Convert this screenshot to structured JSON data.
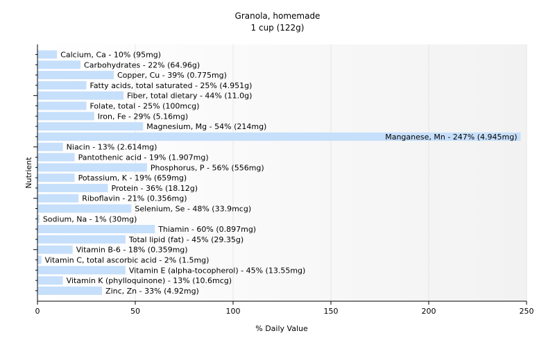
{
  "chart_data": {
    "type": "bar",
    "orientation": "horizontal",
    "title": "Granola, homemade",
    "subtitle": "1 cup (122g)",
    "xlabel": "% Daily Value",
    "ylabel": "Nutrient",
    "xlim": [
      0,
      250
    ],
    "xticks": [
      0,
      50,
      100,
      150,
      200,
      250
    ],
    "grid": true,
    "legend": "none",
    "categories": [
      "Calcium, Ca - 10% (95mg)",
      "Carbohydrates - 22% (64.96g)",
      "Copper, Cu - 39% (0.775mg)",
      "Fatty acids, total saturated - 25% (4.951g)",
      "Fiber, total dietary - 44% (11.0g)",
      "Folate, total - 25% (100mcg)",
      "Iron, Fe - 29% (5.16mg)",
      "Magnesium, Mg - 54% (214mg)",
      "Manganese, Mn - 247% (4.945mg)",
      "Niacin - 13% (2.614mg)",
      "Pantothenic acid - 19% (1.907mg)",
      "Phosphorus, P - 56% (556mg)",
      "Potassium, K - 19% (659mg)",
      "Protein - 36% (18.12g)",
      "Riboflavin - 21% (0.356mg)",
      "Selenium, Se - 48% (33.9mcg)",
      "Sodium, Na - 1% (30mg)",
      "Thiamin - 60% (0.897mg)",
      "Total lipid (fat) - 45% (29.35g)",
      "Vitamin B-6 - 18% (0.359mg)",
      "Vitamin C, total ascorbic acid - 2% (1.5mg)",
      "Vitamin E (alpha-tocopherol) - 45% (13.55mg)",
      "Vitamin K (phylloquinone) - 13% (10.6mcg)",
      "Zinc, Zn - 33% (4.92mg)"
    ],
    "values": [
      10,
      22,
      39,
      25,
      44,
      25,
      29,
      54,
      247,
      13,
      19,
      56,
      19,
      36,
      21,
      48,
      1,
      60,
      45,
      18,
      2,
      45,
      13,
      33
    ],
    "colors": {
      "bar": "#c6dffb",
      "grid": "#e6e6e6",
      "axis": "#000000",
      "text": "#000000"
    }
  }
}
